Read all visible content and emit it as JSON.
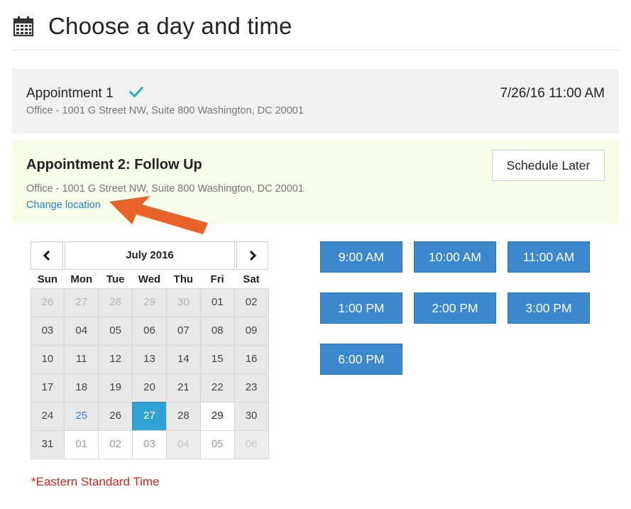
{
  "header": {
    "title": "Choose a day and time",
    "icon": "calendar-icon"
  },
  "appointment1": {
    "title": "Appointment 1",
    "address": "Office - 1001 G Street NW, Suite 800 Washington, DC 20001",
    "datetime": "7/26/16 11:00 AM",
    "status_icon": "checkmark-icon",
    "status_color": "#2ab5a8"
  },
  "appointment2": {
    "title": "Appointment 2: Follow Up",
    "address": "Office - 1001 G Street NW, Suite 800 Washington, DC 20001",
    "change_location": "Change location",
    "schedule_later": "Schedule Later"
  },
  "annotation": {
    "icon": "arrow-icon",
    "color": "#e8622a"
  },
  "calendar": {
    "month_label": "July 2016",
    "prev_icon": "chevron-left-icon",
    "next_icon": "chevron-right-icon",
    "weekdays": [
      "Sun",
      "Mon",
      "Tue",
      "Wed",
      "Thu",
      "Fri",
      "Sat"
    ],
    "days": [
      "26",
      "27",
      "28",
      "29",
      "30",
      "01",
      "02",
      "03",
      "04",
      "05",
      "06",
      "07",
      "08",
      "09",
      "10",
      "11",
      "12",
      "13",
      "14",
      "15",
      "16",
      "17",
      "18",
      "19",
      "20",
      "21",
      "22",
      "23",
      "24",
      "25",
      "26",
      "27",
      "28",
      "29",
      "30",
      "31",
      "01",
      "02",
      "03",
      "04",
      "05",
      "06"
    ],
    "selected_day": "27",
    "today_day": "25",
    "selected_color": "#2fa3d3"
  },
  "timezone_note": "*Eastern Standard Time",
  "time_slots": [
    "9:00 AM",
    "10:00 AM",
    "11:00 AM",
    "1:00 PM",
    "2:00 PM",
    "3:00 PM",
    "6:00 PM"
  ],
  "slot_color": "#3b88cc"
}
